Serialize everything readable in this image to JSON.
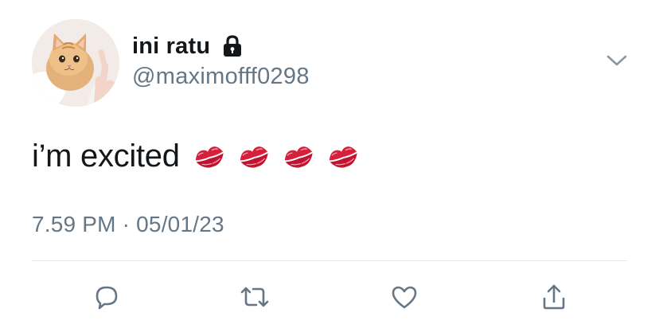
{
  "user": {
    "display_name": "ini ratu",
    "handle": "@maximofff0298",
    "verified_lock": true
  },
  "tweet": {
    "text": "i’m excited",
    "emoji": [
      "kiss-mark-icon",
      "kiss-mark-icon",
      "kiss-mark-icon",
      "kiss-mark-icon"
    ],
    "timestamp": "7.59 PM · 05/01/23"
  },
  "actions": [
    "reply-icon",
    "retweet-icon",
    "like-icon",
    "share-icon"
  ],
  "colors": {
    "text": "#14171a",
    "secondary": "#657786",
    "divider": "#e1e8ed",
    "icon": "#657786",
    "kiss": "#d61f3a"
  }
}
